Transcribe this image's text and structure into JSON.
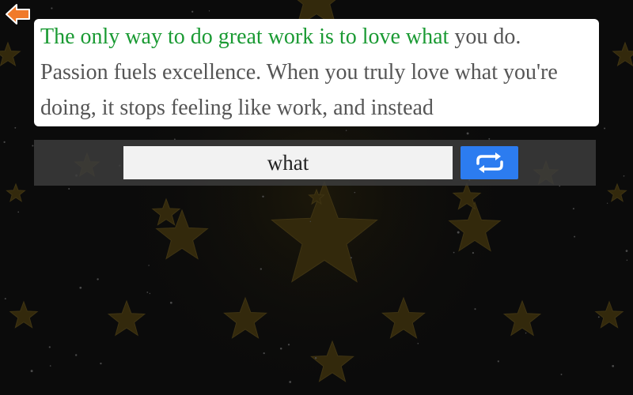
{
  "passage": {
    "typed_text": "The only way to do great work is to love what",
    "remaining_text": " you do. Passion fuels excellence. When you truly love what you're doing, it stops feeling like work, and instead"
  },
  "input": {
    "value": "what"
  },
  "icons": {
    "back": "arrow-left-icon",
    "restart": "repeat-icon",
    "background": "stars-pattern"
  },
  "colors": {
    "typed": "#1a9a33",
    "remaining": "#555555",
    "back_arrow": "#f07a2a",
    "restart_button": "#2c7cf0",
    "star": "#3a2f10"
  }
}
